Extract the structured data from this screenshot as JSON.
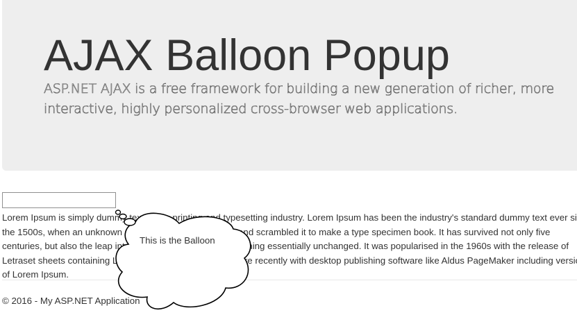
{
  "header": {
    "title": "AJAX Balloon Popup",
    "lead": "ASP.NET AJAX is a free framework for building a new generation of richer, more interactive, highly personalized cross-browser web applications."
  },
  "input": {
    "value": ""
  },
  "content": {
    "text": "Lorem Ipsum is simply dummy text of the printing and typesetting industry. Lorem Ipsum has been the industry's standard dummy text ever since the 1500s, when an unknown printer took a galley of type and scrambled it to make a type specimen book. It has survived not only five centuries, but also the leap into electronic typesetting, remaining essentially unchanged. It was popularised in the 1960s with the release of Letraset sheets containing Lorem Ipsum passages, and more recently with desktop publishing software like Aldus PageMaker including versions of Lorem Ipsum."
  },
  "balloon": {
    "text": "This is the Balloon",
    "fill": "#ffffff",
    "stroke": "#000000"
  },
  "footer": {
    "text": "© 2016 - My ASP.NET Application"
  },
  "colors": {
    "jumbotron_bg": "#eeeeee",
    "text": "#333333"
  }
}
